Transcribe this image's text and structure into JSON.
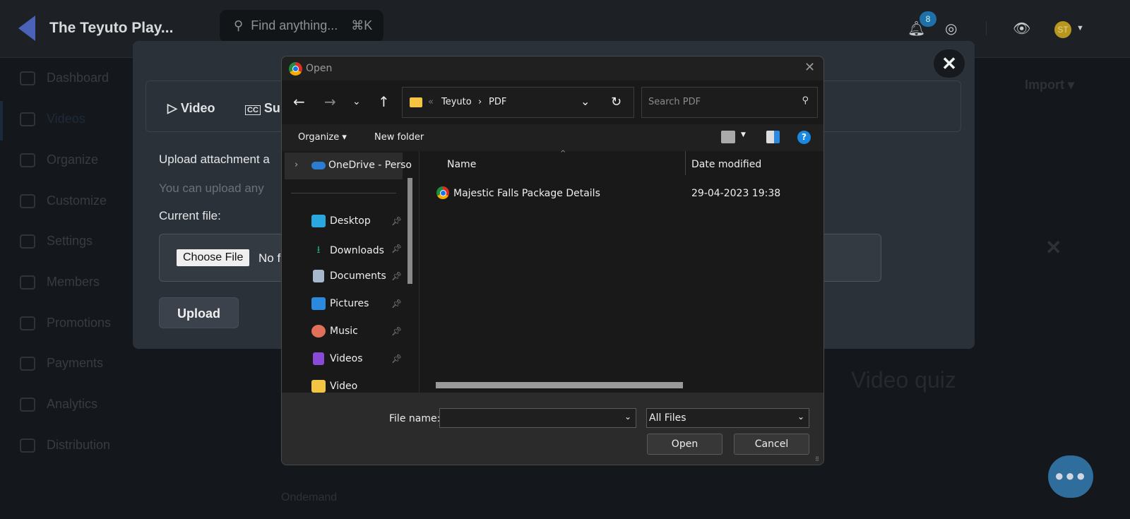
{
  "header": {
    "brand": "The Teyuto Play...",
    "search_placeholder": "Find anything...",
    "search_shortcut": "⌘K",
    "notification_count": "8",
    "avatar_initials": "ST"
  },
  "sidebar": {
    "items": [
      {
        "label": "Dashboard"
      },
      {
        "label": "Videos"
      },
      {
        "label": "Organize"
      },
      {
        "label": "Customize"
      },
      {
        "label": "Settings"
      },
      {
        "label": "Members"
      },
      {
        "label": "Promotions"
      },
      {
        "label": "Payments"
      },
      {
        "label": "Analytics"
      },
      {
        "label": "Distribution"
      }
    ]
  },
  "background": {
    "import_label": "Import",
    "video_quiz": "Video quiz",
    "ondemand": "Ondemand"
  },
  "modal": {
    "tabs": [
      {
        "label": "Video",
        "icon": "play-icon"
      },
      {
        "label": "Sub",
        "icon": "cc-icon"
      }
    ],
    "heading": "Upload attachment a",
    "subtext": "You can upload any",
    "current_file_label": "Current file:",
    "choose_file": "Choose File",
    "no_file": "No f",
    "upload": "Upload"
  },
  "dialog": {
    "title": "Open",
    "breadcrumb": [
      "Teyuto",
      "PDF"
    ],
    "search_placeholder": "Search PDF",
    "organize": "Organize",
    "new_folder": "New folder",
    "nav": [
      {
        "label": "OneDrive - Perso",
        "color": "#2b7cd3"
      },
      {
        "label": "Desktop",
        "color": "#2aa7e0"
      },
      {
        "label": "Downloads",
        "color": "#1fae7a"
      },
      {
        "label": "Documents",
        "color": "#a8b8cc"
      },
      {
        "label": "Pictures",
        "color": "#2b8ae0"
      },
      {
        "label": "Music",
        "color": "#e0705a"
      },
      {
        "label": "Videos",
        "color": "#8a4ad8"
      },
      {
        "label": "Video",
        "color": "#f4c542"
      }
    ],
    "columns": {
      "name": "Name",
      "date": "Date modified"
    },
    "files": [
      {
        "name": "Majestic Falls Package Details",
        "date": "29-04-2023 19:38"
      }
    ],
    "file_name_label": "File name:",
    "file_name_value": "",
    "file_type": "All Files",
    "open": "Open",
    "cancel": "Cancel"
  }
}
